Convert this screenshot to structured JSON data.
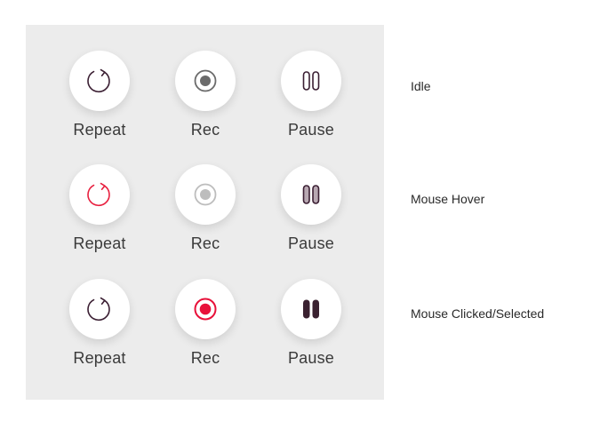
{
  "labels": {
    "repeat": "Repeat",
    "rec": "Rec",
    "pause": "Pause"
  },
  "states": {
    "idle": "Idle",
    "hover": "Mouse Hover",
    "clicked": "Mouse Clicked/Selected"
  },
  "icons": {
    "repeat": "repeat-icon",
    "record": "record-icon",
    "pause": "pause-icon"
  },
  "colors": {
    "panel_background": "#ececec",
    "button_background": "#ffffff",
    "idle_dark": "#3b1f33",
    "idle_gray": "#6b6b6b",
    "hover_red": "#e8203f",
    "hover_gray": "#bdbdbd",
    "hover_pause_fill": "#b8a8b2",
    "selected_red": "#e8113a",
    "selected_dark": "#3a2130",
    "label_text": "#3a3a3a"
  }
}
